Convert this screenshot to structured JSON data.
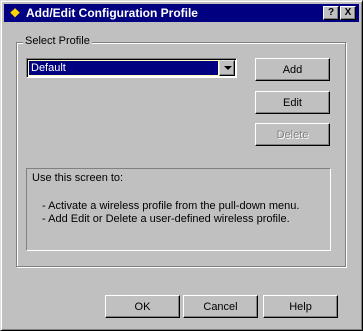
{
  "window": {
    "title": "Add/Edit Configuration Profile",
    "help_glyph": "?",
    "close_glyph": "X"
  },
  "group": {
    "label": "Select Profile"
  },
  "profile_select": {
    "selected": "Default"
  },
  "buttons": {
    "add": "Add",
    "edit": "Edit",
    "delete": "Delete",
    "ok": "OK",
    "cancel": "Cancel",
    "help": "Help"
  },
  "info": {
    "heading": "Use this screen to:",
    "items": [
      "-  Activate a wireless profile from the pull-down menu.",
      "-  Add Edit or Delete a user-defined wireless profile."
    ]
  },
  "colors": {
    "titlebar": "#000080",
    "face": "#c0c0c0",
    "selection": "#000080"
  }
}
